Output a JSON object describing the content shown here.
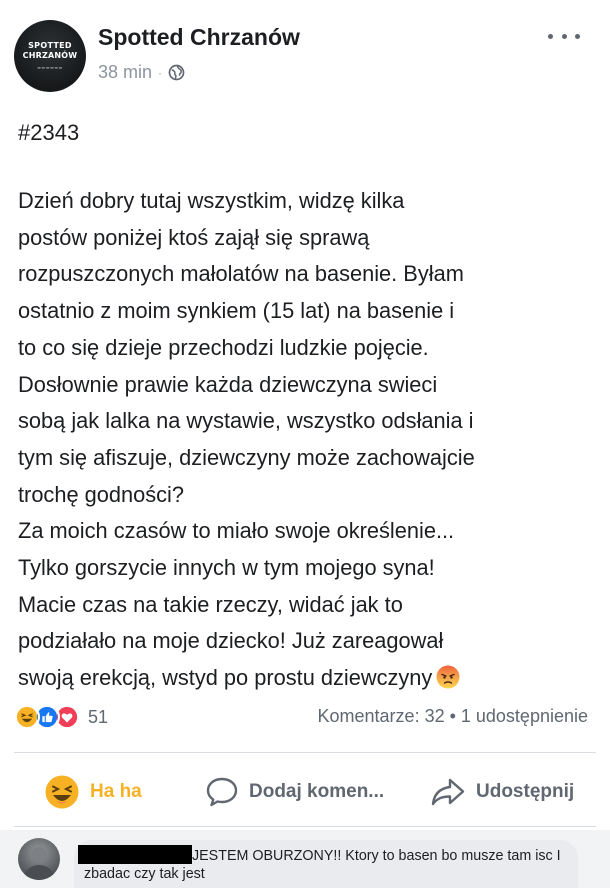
{
  "header": {
    "page_name": "Spotted Chrzanów",
    "timestamp": "38 min",
    "separator": "·",
    "privacy_icon": "globe-icon",
    "avatar_logo": {
      "line1": "SPOTTED",
      "line2": "CHRZANÓW"
    },
    "menu_icon": "more-horizontal-icon"
  },
  "post": {
    "hashtag": "#2343",
    "text": "Dzień dobry tutaj wszystkim, widzę kilka\npostów poniżej ktoś zajął się sprawą\nrozpuszczonych małolatów na basenie. Byłam\nostatnio z moim synkiem (15 lat) na basenie i\nto co się dzieje przechodzi ludzkie pojęcie.\nDosłownie prawie każda dziewczyna swieci\nsobą jak lalka na wystawie, wszystko odsłania i\ntym się afiszuje, dziewczyny może zachowajcie\ntrochę godności?\nZa moich czasów to miało swoje określenie...\nTylko gorszycie innych w tym mojego syna!\nMacie czas na takie rzeczy, widać jak to\npodziałało na moje dziecko! Już zareagował\nswoją erekcją, wstyd po prostu dziewczyny",
    "trailing_emoji": "angry-face-icon"
  },
  "stats": {
    "reaction_icons": [
      "haha-reaction-icon",
      "like-reaction-icon",
      "love-reaction-icon"
    ],
    "reaction_count": "51",
    "comments_shares": "Komentarze: 32 • 1 udostępnienie"
  },
  "actions": {
    "haha_label": "Ha ha",
    "comment_label": "Dodaj komen...",
    "share_label": "Udostępnij"
  },
  "comment": {
    "author_redacted": true,
    "text": "JESTEM OBURZONY!! Ktory to basen bo musze tam isc I zbadac czy tak jest"
  },
  "colors": {
    "haha_yellow": "#f7b125",
    "like_blue": "#1877f2",
    "love_red": "#f33e58",
    "text_primary": "#1c1e21",
    "text_secondary": "#606770",
    "meta_gray": "#8d949e"
  }
}
